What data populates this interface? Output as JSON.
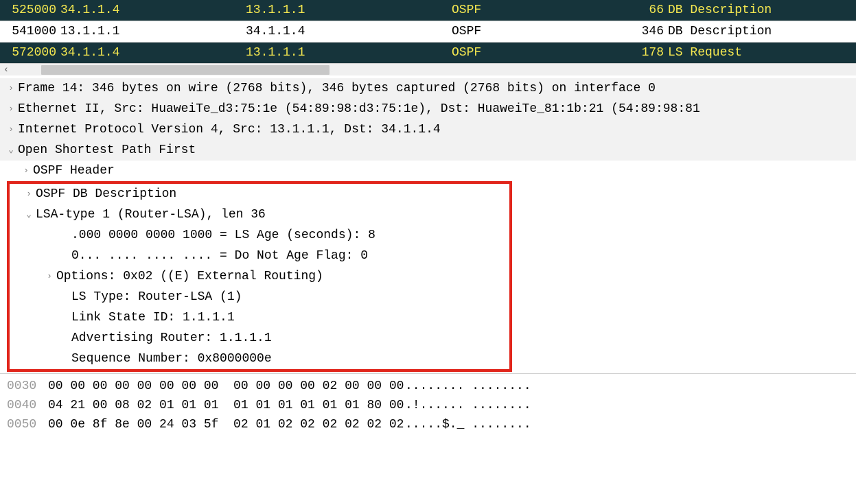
{
  "packets": [
    {
      "num": "525000",
      "src": "34.1.1.4",
      "dst": "13.1.1.1",
      "proto": "OSPF",
      "len": "66",
      "info": "DB Description",
      "cls": "dark"
    },
    {
      "num": "541000",
      "src": "13.1.1.1",
      "dst": "34.1.1.4",
      "proto": "OSPF",
      "len": "346",
      "info": "DB Description",
      "cls": "light"
    },
    {
      "num": "572000",
      "src": "34.1.1.4",
      "dst": "13.1.1.1",
      "proto": "OSPF",
      "len": "178",
      "info": "LS Request",
      "cls": "dark"
    }
  ],
  "details": {
    "frame": "Frame 14: 346 bytes on wire (2768 bits), 346 bytes captured (2768 bits) on interface 0",
    "eth": "Ethernet II, Src: HuaweiTe_d3:75:1e (54:89:98:d3:75:1e), Dst: HuaweiTe_81:1b:21 (54:89:98:81",
    "ip": "Internet Protocol Version 4, Src: 13.1.1.1, Dst: 34.1.1.4",
    "ospf": "Open Shortest Path First",
    "ospf_header": "OSPF Header",
    "ospf_dbd": "OSPF DB Description",
    "lsa_hdr": "LSA-type 1 (Router-LSA), len 36",
    "ls_age": ".000 0000 0000 1000 = LS Age (seconds): 8",
    "dna": "0... .... .... .... = Do Not Age Flag: 0",
    "options": "Options: 0x02 ((E) External Routing)",
    "ls_type": "LS Type: Router-LSA (1)",
    "ls_id": "Link State ID: 1.1.1.1",
    "adv_rtr": "Advertising Router: 1.1.1.1",
    "seq": "Sequence Number: 0x8000000e"
  },
  "hex": [
    {
      "off": "0030",
      "bytes": "00 00 00 00 00 00 00 00  00 00 00 00 02 00 00 00",
      "ascii": "........ ........"
    },
    {
      "off": "0040",
      "bytes": "04 21 00 08 02 01 01 01  01 01 01 01 01 01 80 00",
      "ascii": ".!...... ........"
    },
    {
      "off": "0050",
      "bytes": "00 0e 8f 8e 00 24 03 5f  02 01 02 02 02 02 02 02",
      "ascii": ".....$._ ........"
    }
  ]
}
